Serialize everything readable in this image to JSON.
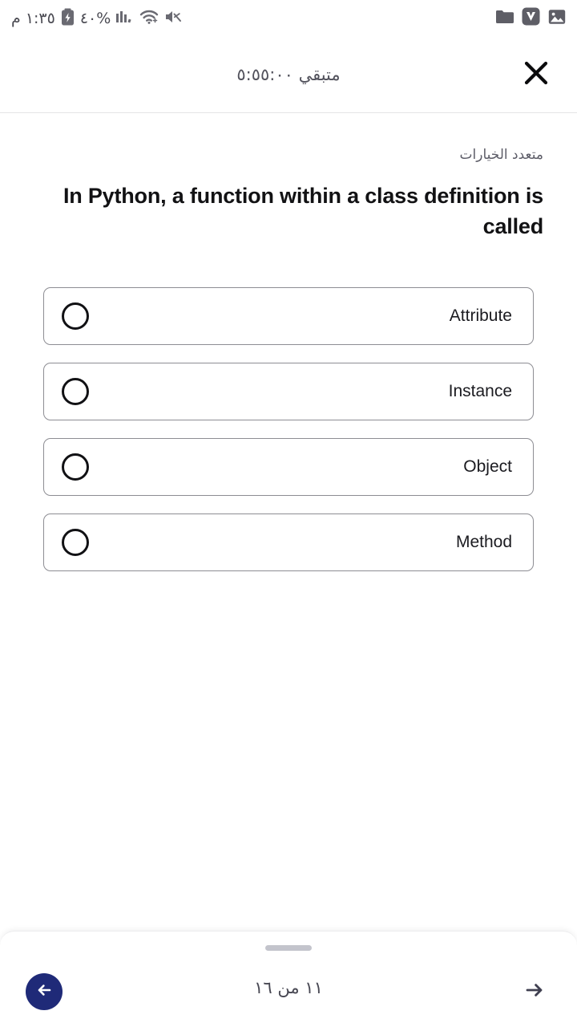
{
  "status_bar": {
    "clock": "١:٣٥ م",
    "battery_percent": "٤٠%",
    "icons": {
      "battery": "battery-charging-icon",
      "signal": "cellular-signal-icon",
      "wifi": "wifi-icon",
      "mute": "speaker-mute-icon",
      "folder": "folder-icon",
      "app": "v-app-icon",
      "gallery": "photo-icon"
    }
  },
  "header": {
    "timer_text": "متبقي ٥:٥٥:٠٠",
    "close_label": "close-icon"
  },
  "quiz": {
    "question_type": "متعدد الخيارات",
    "question_text": "In Python, a function within a class definition is called",
    "options": [
      {
        "label": "Attribute",
        "selected": false
      },
      {
        "label": "Instance",
        "selected": false
      },
      {
        "label": "Object",
        "selected": false
      },
      {
        "label": "Method",
        "selected": false
      }
    ]
  },
  "footer": {
    "counter_text": "١١ من ١٦",
    "prev_label": "previous-question",
    "next_label": "next-question"
  },
  "colors": {
    "accent": "#1f2a78",
    "text": "#1b1b20",
    "muted": "#5d5d68",
    "border": "#8d8d93",
    "handle": "#c3c4cc"
  }
}
